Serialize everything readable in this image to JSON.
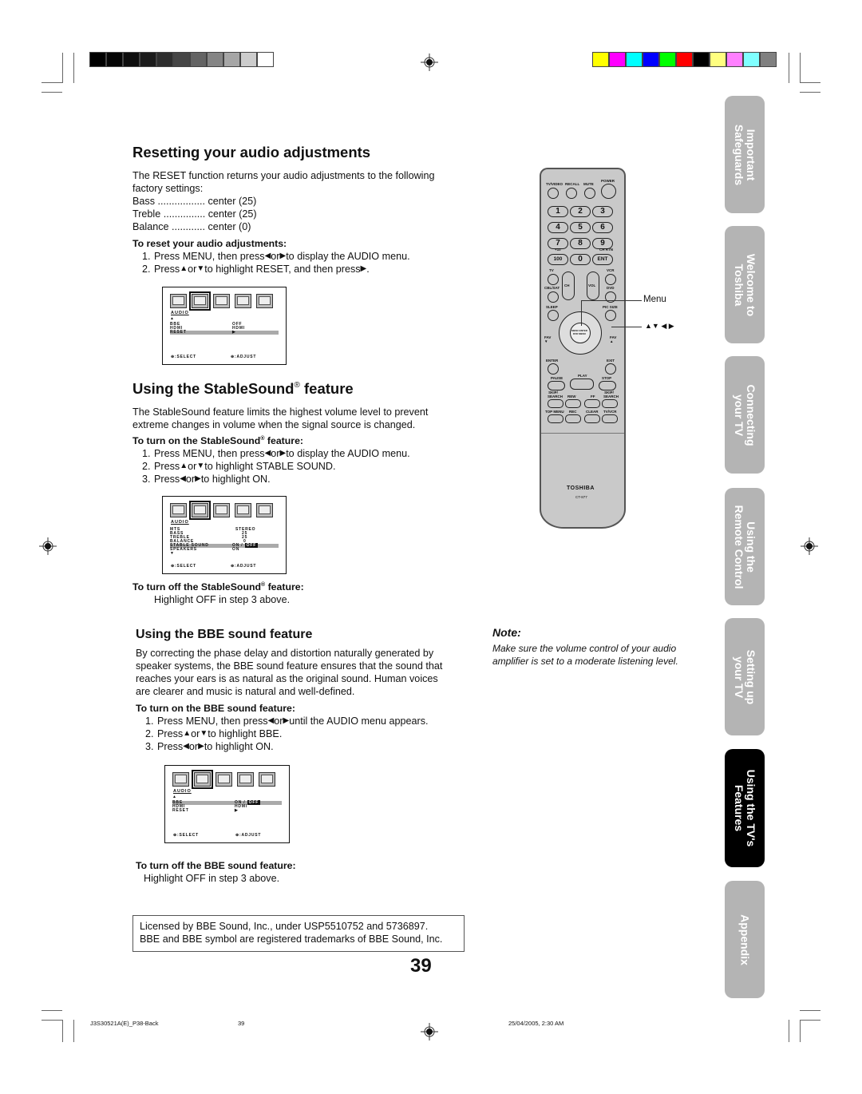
{
  "color_bars": {
    "grayscale": [
      "#000000",
      "#050505",
      "#0e0e0e",
      "#1c1c1c",
      "#2e2e2e",
      "#464646",
      "#646464",
      "#858585",
      "#a6a6a6",
      "#cccccc",
      "#ffffff"
    ],
    "colors": [
      "#ffff00",
      "#ff00ff",
      "#00ffff",
      "#0000ff",
      "#00ff00",
      "#ff0000",
      "#000000",
      "#ffff80",
      "#ff80ff",
      "#80ffff",
      "#808080"
    ]
  },
  "reset_section": {
    "title": "Resetting your audio adjustments",
    "intro_line1": "The RESET function returns your audio adjustments to the following",
    "intro_line2": "factory settings:",
    "settings": [
      {
        "name": "Bass",
        "dots": " .................",
        "value": " center (25)"
      },
      {
        "name": "Treble",
        "dots": " ...............",
        "value": " center (25)"
      },
      {
        "name": "Balance",
        "dots": " ............",
        "value": " center (0)"
      }
    ],
    "subheading": "To reset your audio adjustments:",
    "steps": [
      {
        "num": "1.",
        "pre": "Press MENU, then press ",
        "mid": " or ",
        "post": " to display the AUDIO menu."
      },
      {
        "num": "2.",
        "pre": "Press ",
        "mid": " or ",
        "post": " to highlight RESET, and then press "
      }
    ],
    "step2_end": "."
  },
  "osd_reset": {
    "title": "AUDIO",
    "rows": [
      {
        "label": "BBE",
        "value": "OFF",
        "highlight": false
      },
      {
        "label": "HDMI",
        "value": "HDMI",
        "highlight": false
      },
      {
        "label": "RESET",
        "value": "▶",
        "highlight": true
      }
    ],
    "select_label": ":SELECT",
    "adjust_label": ":ADJUST"
  },
  "stable_section": {
    "title": "Using the StableSound",
    "title_reg": "®",
    "title_end": " feature",
    "intro_line1": "The StableSound feature limits the highest volume level to prevent",
    "intro_line2": "extreme changes in volume when the signal source is changed.",
    "sub_on": "To turn on the StableSound",
    "sub_on_end": " feature:",
    "steps": [
      {
        "num": "1.",
        "pre": "Press MENU, then press ",
        "mid": " or ",
        "post": " to display the AUDIO menu."
      },
      {
        "num": "2.",
        "pre": "Press ",
        "mid": " or ",
        "post": " to highlight STABLE SOUND."
      },
      {
        "num": "3.",
        "pre": "Press ",
        "mid": " or ",
        "post": " to highlight ON."
      }
    ],
    "sub_off": "To turn off the StableSound",
    "sub_off_end": " feature:",
    "off_text": "Highlight OFF in step 3 above."
  },
  "osd_stable": {
    "title": "AUDIO",
    "rows": [
      {
        "label": "MTS",
        "value": "STEREO"
      },
      {
        "label": "BASS",
        "value": "25"
      },
      {
        "label": "TREBLE",
        "value": "25"
      },
      {
        "label": "BALANCE",
        "value": "0"
      },
      {
        "label": "STABLE SOUND",
        "value": "ON / ",
        "value2": "OFF"
      },
      {
        "label": "SPEAKERS",
        "value": "ON"
      }
    ],
    "select_label": ":SELECT",
    "adjust_label": ":ADJUST"
  },
  "bbe_section": {
    "title": "Using the BBE sound feature",
    "intro": [
      "By correcting the phase delay and distortion naturally generated by",
      "speaker systems, the BBE sound feature ensures that the sound that",
      "reaches your ears is as natural as the original sound. Human voices",
      "are clearer and music is natural and well-defined."
    ],
    "sub_on": "To turn on the BBE sound feature:",
    "steps": [
      {
        "num": "1.",
        "pre": "Press MENU, then press ",
        "mid": " or ",
        "post": " until the AUDIO menu appears."
      },
      {
        "num": "2.",
        "pre": "Press ",
        "mid": " or ",
        "post": " to highlight BBE."
      },
      {
        "num": "3.",
        "pre": "Press ",
        "mid": " or ",
        "post": " to highlight ON."
      }
    ],
    "sub_off": "To turn off the BBE sound feature:",
    "off_text": "Highlight OFF in step 3 above."
  },
  "osd_bbe": {
    "title": "AUDIO",
    "rows": [
      {
        "label": "BBE",
        "value": "ON / ",
        "value2": "OFF"
      },
      {
        "label": "HDMI",
        "value": "HDMI"
      },
      {
        "label": "RESET",
        "value": "▶"
      }
    ],
    "select_label": ":SELECT",
    "adjust_label": ":ADJUST"
  },
  "license": {
    "line1": "Licensed by BBE Sound, Inc., under USP5510752 and 5736897.",
    "line2": "BBE and BBE symbol are registered trademarks of BBE Sound, Inc."
  },
  "page_number": "39",
  "note": {
    "label": "Note:",
    "line1": "Make sure the volume control of your audio",
    "line2": "amplifier is set to a moderate listening level."
  },
  "remote": {
    "callout_menu": "Menu",
    "callout_arrows": "▲▼ ◀ ▶",
    "brand": "TOSHIBA",
    "model": "CT-877",
    "top_labels": [
      "TV/VIDEO",
      "RECALL",
      "MUTE",
      "POWER"
    ],
    "number_keys": [
      "1",
      "2",
      "3",
      "4",
      "5",
      "6",
      "7",
      "8",
      "9",
      "100",
      "0",
      "ENT"
    ],
    "labels": {
      "plus10": "+10",
      "chrtn": "CH RTN",
      "tv": "TV",
      "vcr": "VCR",
      "cblsat": "CBL/SAT",
      "ch": "CH",
      "vol": "VOL",
      "dvd": "DVD",
      "sleep": "SLEEP",
      "picsize": "PIC SIZE",
      "fav_down": "FAV ▼",
      "fav_up": "FAV ▲",
      "menu_center": "MENU ENTER DVD MENU",
      "enter": "ENTER",
      "exit": "EXIT",
      "pause": "PAUSE",
      "play": "PLAY",
      "stop": "STOP",
      "skip_back": "SKIP/ SEARCH",
      "rew": "REW",
      "ff": "FF",
      "skip_fwd": "SKIP/ SEARCH",
      "topmenu": "TOP MENU",
      "rec": "REC",
      "clear": "CLEAR",
      "tvvcr": "TV/VCR"
    }
  },
  "side_tabs": [
    {
      "line1": "Important",
      "line2": "Safeguards",
      "active": false
    },
    {
      "line1": "Welcome to",
      "line2": "Toshiba",
      "active": false
    },
    {
      "line1": "Connecting",
      "line2": "your TV",
      "active": false
    },
    {
      "line1": "Using the",
      "line2": "Remote Control",
      "active": false
    },
    {
      "line1": "Setting up",
      "line2": "your TV",
      "active": false
    },
    {
      "line1": "Using the TV's",
      "line2": "Features",
      "active": true
    },
    {
      "line1": "Appendix",
      "line2": "",
      "active": false
    }
  ],
  "footer": {
    "file": "J3S30521A(E)_P38-Back",
    "page": "39",
    "datetime": "25/04/2005, 2:30 AM"
  },
  "glyphs": {
    "left": "◀",
    "right": "▶",
    "up": "▲",
    "down": "▼"
  }
}
